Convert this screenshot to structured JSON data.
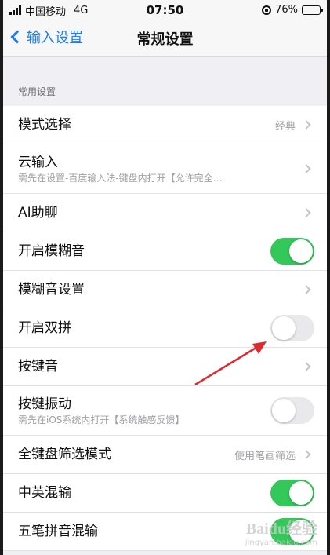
{
  "status_bar": {
    "carrier": "中国移动",
    "network": "4G",
    "time": "07:50",
    "battery": "76%",
    "battery_level": 0.76,
    "battery_color": "#f5c400"
  },
  "nav": {
    "back_label": "输入设置",
    "title": "常规设置"
  },
  "section": {
    "header": "常用设置"
  },
  "rows": [
    {
      "title": "模式选择",
      "value": "经典",
      "type": "chevron"
    },
    {
      "title": "云输入",
      "subtitle": "需先在设置-百度输入法-键盘内打开【允许完全…",
      "type": "chevron"
    },
    {
      "title": "AI助聊",
      "type": "chevron"
    },
    {
      "title": "开启模糊音",
      "type": "toggle",
      "on": true
    },
    {
      "title": "模糊音设置",
      "type": "chevron"
    },
    {
      "title": "开启双拼",
      "type": "toggle",
      "on": false
    },
    {
      "title": "按键音",
      "type": "chevron"
    },
    {
      "title": "按键振动",
      "subtitle": "需先在iOS系统内打开【系统触感反馈】",
      "type": "toggle",
      "on": false
    },
    {
      "title": "全键盘筛选模式",
      "value": "使用笔画筛选",
      "type": "chevron"
    },
    {
      "title": "中英混输",
      "type": "toggle",
      "on": true
    },
    {
      "title": "五笔拼音混输",
      "type": "toggle",
      "on": true
    }
  ],
  "colors": {
    "accent": "#1a7cf6",
    "toggle_on": "#34c759",
    "annotation_arrow": "#e0282e"
  },
  "watermark": {
    "main": "Baidu经验",
    "sub": "jingyan.baidu.com"
  }
}
